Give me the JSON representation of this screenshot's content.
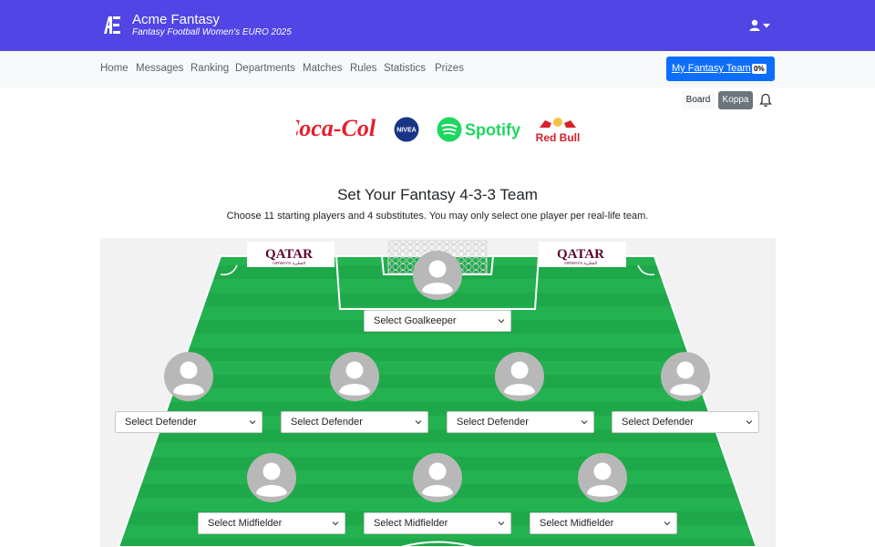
{
  "header": {
    "logo_text": "Æ",
    "app_name": "Acme Fantasy",
    "subtitle": "Fantasy Football Women's EURO 2025",
    "user_icon": "user-icon",
    "caret_icon": "caret-down-icon",
    "brand_color": "#5146e5"
  },
  "nav": {
    "items": [
      {
        "label": "Home"
      },
      {
        "label": "Messages"
      },
      {
        "label": "Ranking"
      },
      {
        "label": "Departments"
      },
      {
        "label": "Matches"
      },
      {
        "label": "Rules"
      },
      {
        "label": "Statistics"
      },
      {
        "label": "Prizes"
      }
    ],
    "my_team_label": "My Fantasy Team",
    "my_team_percent": "0%",
    "accent_color": "#0d6efd"
  },
  "toggles": {
    "board_label": "Board",
    "koppa_label": "Koppa",
    "active": "Koppa",
    "bell_icon": "bell-icon"
  },
  "sponsors": {
    "cocacola": "Coca-Cola",
    "nivea": "NIVEA",
    "spotify": "Spotify",
    "redbull": "Red Bull"
  },
  "main": {
    "title": "Set Your Fantasy 4-3-3 Team",
    "instructions": "Choose 11 starting players and 4 substitutes. You may only select one player per real-life team."
  },
  "pitch": {
    "board_left": "QATAR",
    "board_left_sub": "AIRWAYS القطرية",
    "board_right": "QATAR",
    "board_right_sub": "AIRWAYS القطرية",
    "pitch_color": "#1fa84a",
    "goalkeeper": {
      "placeholder": "Select Goalkeeper"
    },
    "defenders": [
      {
        "placeholder": "Select Defender"
      },
      {
        "placeholder": "Select Defender"
      },
      {
        "placeholder": "Select Defender"
      },
      {
        "placeholder": "Select Defender"
      }
    ],
    "midfielders": [
      {
        "placeholder": "Select Midfielder"
      },
      {
        "placeholder": "Select Midfielder"
      },
      {
        "placeholder": "Select Midfielder"
      }
    ]
  }
}
